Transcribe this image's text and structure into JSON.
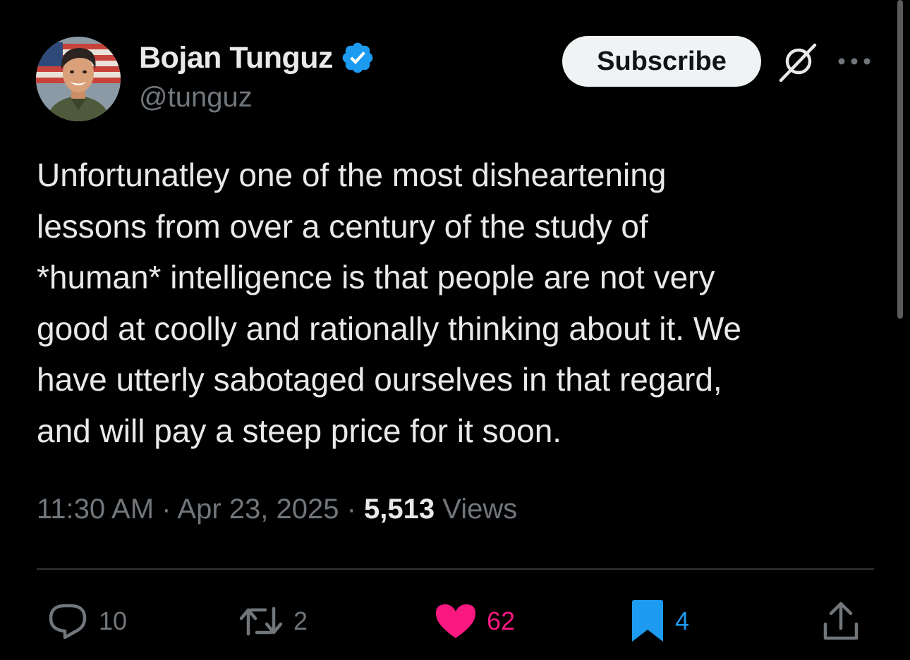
{
  "author": {
    "display_name": "Bojan Tunguz",
    "handle": "@tunguz"
  },
  "header": {
    "subscribe_label": "Subscribe"
  },
  "post": {
    "text": "Unfortunatley one of the most disheartening\nlessons from over a century of the study of\n*human* intelligence is that people are not very\ngood at coolly and rationally thinking about it. We\nhave utterly sabotaged ourselves in that regard,\nand will pay a steep price for it soon.",
    "time": "11:30 AM",
    "separator": "·",
    "date": "Apr 23, 2025",
    "views_count": "5,513",
    "views_label": "Views"
  },
  "actions": {
    "replies": "10",
    "reposts": "2",
    "likes": "62",
    "bookmarks": "4"
  },
  "icons": {
    "verified": "verified-badge-icon",
    "grok": "grok-icon",
    "more": "more-icon",
    "reply": "reply-icon",
    "repost": "repost-icon",
    "like": "heart-icon",
    "bookmark": "bookmark-icon",
    "share": "share-icon"
  },
  "colors": {
    "background": "#000000",
    "primary_text": "#e7e9ea",
    "secondary_text": "#71767b",
    "verified_blue": "#1d9bf0",
    "like_pink": "#f91880",
    "bookmark_blue": "#1d9bf0",
    "divider": "#2f3336"
  }
}
